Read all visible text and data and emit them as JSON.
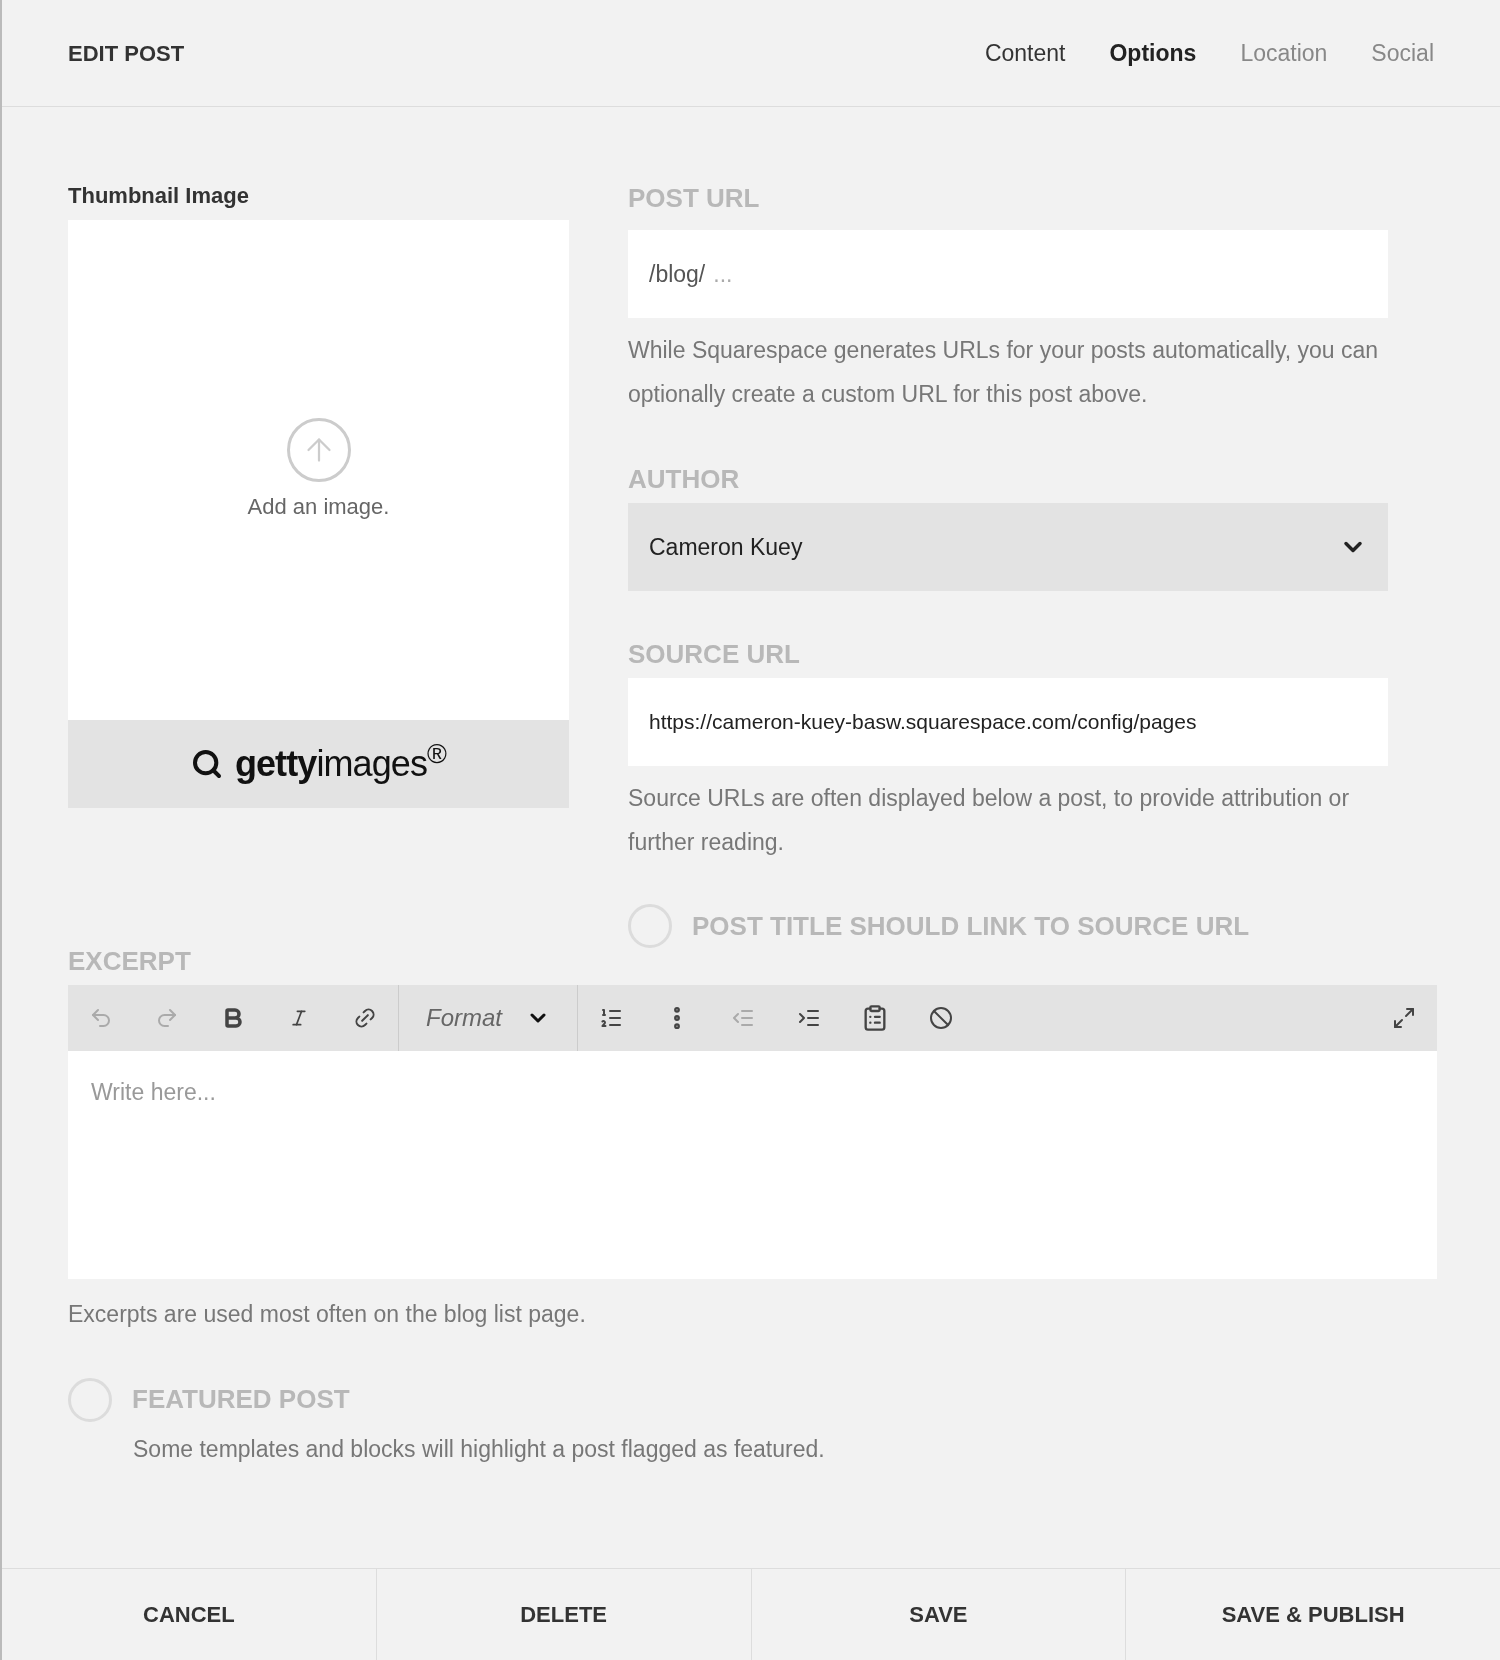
{
  "header": {
    "title": "EDIT POST",
    "tabs": [
      {
        "label": "Content",
        "selected": false
      },
      {
        "label": "Options",
        "selected": true
      },
      {
        "label": "Location",
        "selected": false
      },
      {
        "label": "Social",
        "selected": false
      }
    ]
  },
  "thumbnail": {
    "label": "Thumbnail Image",
    "prompt": "Add an image.",
    "stock_logo": "**getty**images$^{®}$"
  },
  "post_url": {
    "label": "POST URL",
    "value": "/blog/",
    "placeholder": "...",
    "help": "While Squarespace generates URLs for your posts automatically, you can optionally create a custom URL for this post above."
  },
  "author": {
    "label": "AUTHOR",
    "value": "Cameron Kuey"
  },
  "source_url": {
    "label": "SOURCE URL",
    "value": "https://cameron-kuey-basw.squarespace.com/config/pages",
    "help": "Source URLs are often displayed below a post, to provide attribution or further reading."
  },
  "link_to_source": {
    "label": "POST TITLE SHOULD LINK TO SOURCE URL",
    "checked": false
  },
  "excerpt": {
    "label": "EXCERPT",
    "format": "Format",
    "placeholder": "Write here...",
    "help": "Excerpts are used most often on the blog list page."
  },
  "featured": {
    "label": "FEATURED POST",
    "checked": false,
    "help": "Some templates and blocks will highlight a post flagged as featured."
  },
  "footer": {
    "buttons": [
      "CANCEL",
      "DELETE",
      "SAVE",
      "SAVE & PUBLISH"
    ]
  }
}
